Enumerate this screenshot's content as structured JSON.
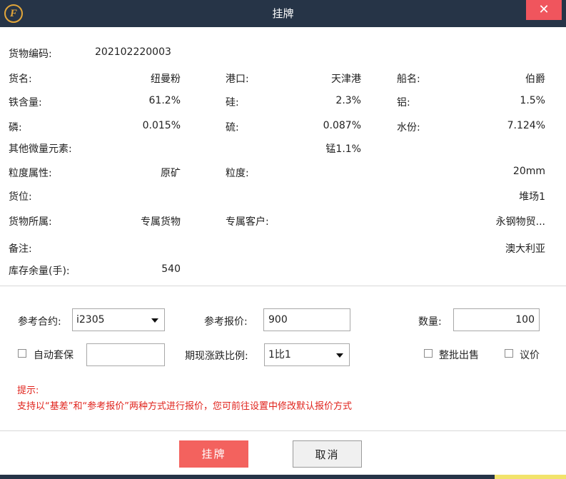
{
  "window": {
    "title": "挂牌",
    "close_glyph": "✕",
    "logo_glyph": "F"
  },
  "info": {
    "code_label": "货物编码:",
    "code_value": "202102220003",
    "name_label": "货名:",
    "name_value": "纽曼粉",
    "port_label": "港口:",
    "port_value": "天津港",
    "ship_label": "船名:",
    "ship_value": "伯爵",
    "fe_label": "铁含量:",
    "fe_value": "61.2%",
    "si_label": "硅:",
    "si_value": "2.3%",
    "al_label": "铝:",
    "al_value": "1.5%",
    "p_label": "磷:",
    "p_value": "0.015%",
    "s_label": "硫:",
    "s_value": "0.087%",
    "water_label": "水份:",
    "water_value": "7.124%",
    "trace_label": "其他微量元素:",
    "trace_value": "锰1.1%",
    "grain_attr_label": "粒度属性:",
    "grain_attr_value": "原矿",
    "grain_label": "粒度:",
    "grain_value": "20mm",
    "location_label": "货位:",
    "location_value": "堆场1",
    "owner_label": "货物所属:",
    "owner_value": "专属货物",
    "customer_label": "专属客户:",
    "customer_value": "永钢物贸...",
    "remark_label": "备注:",
    "remark_value": "澳大利亚",
    "stock_label": "库存余量(手):",
    "stock_value": "540"
  },
  "form": {
    "contract_label": "参考合约:",
    "contract_value": "i2305",
    "price_label": "参考报价:",
    "price_value": "900",
    "qty_label": "数量:",
    "qty_value": "100",
    "auto_hedge_label": "自动套保",
    "auto_hedge_value": "",
    "ratio_label": "期现涨跌比例:",
    "ratio_value": "1比1",
    "whole_batch_label": "整批出售",
    "negotiable_label": "议价"
  },
  "hint": {
    "title": "提示:",
    "text": "支持以“基差”和“参考报价”两种方式进行报价，您可前往设置中修改默认报价方式"
  },
  "buttons": {
    "submit": "挂牌",
    "cancel": "取消"
  },
  "colors": {
    "titlebar": "#263447",
    "close": "#f0555d",
    "primary": "#f3625e",
    "hint": "#e0231c",
    "logo": "#e2a63a"
  }
}
